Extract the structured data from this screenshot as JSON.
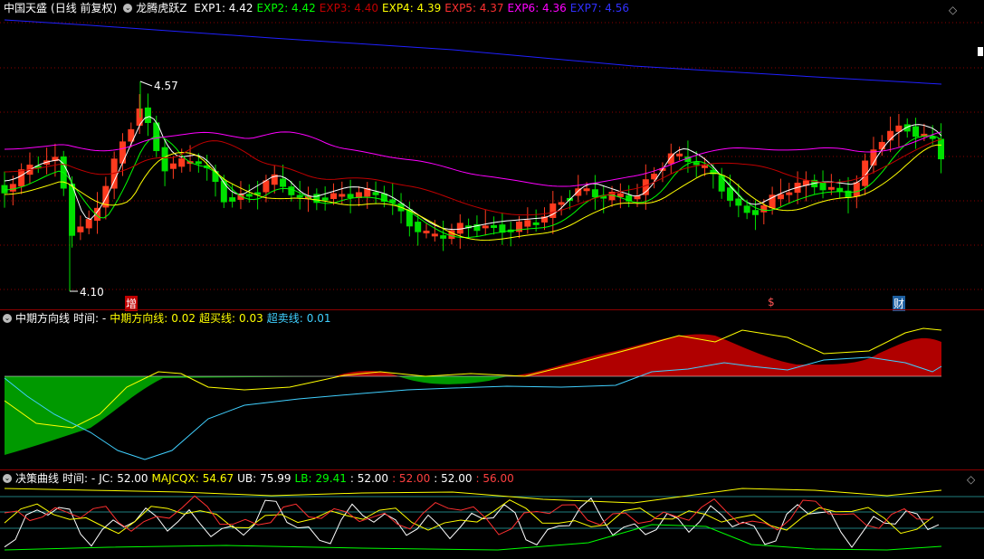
{
  "main": {
    "stock_name": "中国天盛",
    "period": "(日线 前复权)",
    "indicator_name": "龙腾虎跃Z",
    "exps": [
      {
        "label": "EXP1:",
        "value": "4.42",
        "color": "#ffffff"
      },
      {
        "label": "EXP2:",
        "value": "4.42",
        "color": "#00ff00"
      },
      {
        "label": "EXP3:",
        "value": "4.40",
        "color": "#c00000"
      },
      {
        "label": "EXP4:",
        "value": "4.39",
        "color": "#ffff00"
      },
      {
        "label": "EXP5:",
        "value": "4.37",
        "color": "#ff3030"
      },
      {
        "label": "EXP6:",
        "value": "4.36",
        "color": "#ff00ff"
      },
      {
        "label": "EXP7:",
        "value": "4.56",
        "color": "#3030ff"
      }
    ],
    "high_label": "4.57",
    "low_label": "4.10",
    "markers": {
      "zeng": "增",
      "dollar": "$",
      "cai": "财"
    },
    "diamond": "◇"
  },
  "mid": {
    "name": "中期方向线",
    "time_label": "时间: -",
    "l1_label": "中期方向线:",
    "l1_value": "0.02",
    "l2_label": "超买线:",
    "l2_value": "0.03",
    "l3_label": "超卖线:",
    "l3_value": "0.01"
  },
  "bottom": {
    "name": "决策曲线",
    "time_label": "时间: -",
    "jc_label": "JC:",
    "jc_value": "52.00",
    "majcqx_label": "MAJCQX:",
    "majcqx_value": "54.67",
    "ub_label": "UB:",
    "ub_value": "75.99",
    "lb_label": "LB:",
    "lb_value": "29.41",
    "v1": ": 52.00",
    "v2": ": 52.00",
    "v3": ": 52.00",
    "v4": ": 56.00",
    "diamond": "◇"
  },
  "colors": {
    "up": "#ff3b1f",
    "down": "#00e000",
    "grid": "#8b0000",
    "expma_blue": "#2020ff",
    "magenta": "#ff00ff",
    "darkred": "#c00000",
    "fill_red": "#b00000",
    "fill_green": "#009900",
    "cyan": "#40d0ff"
  }
}
